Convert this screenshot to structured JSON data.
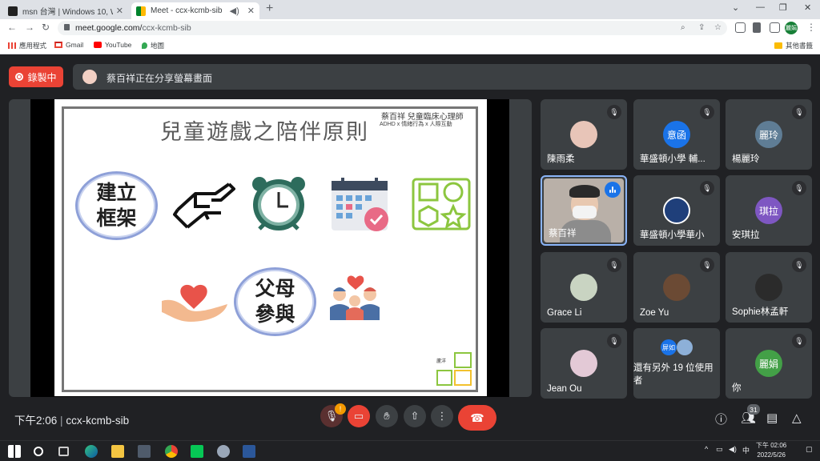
{
  "browser": {
    "tabs": [
      {
        "title": "msn 台灣 | Windows 10, Windo",
        "close": "✕"
      },
      {
        "title": "Meet - ccx-kcmb-sib",
        "close": "✕"
      }
    ],
    "url_host": "meet.google.com/",
    "url_path": "ccx-kcmb-sib",
    "profile": "麗娟",
    "bookmarks": [
      "應用程式",
      "Gmail",
      "YouTube",
      "地圖"
    ],
    "other_bookmarks": "其他書籤"
  },
  "meet": {
    "recording_label": "錄製中",
    "share_notice": "蔡百祥正在分享螢幕畫面",
    "time": "下午2:06",
    "meeting_code": "ccx-kcmb-sib",
    "notification_count": "!",
    "participant_count": "31"
  },
  "slide": {
    "title": "兒童遊戲之陪伴原則",
    "author": "蔡百祥 兒童臨床心理師",
    "subtitle": "ADHD x 情緒行為 x 人際互動",
    "bubble1_line1": "建立",
    "bubble1_line2": "框架",
    "bubble2_line1": "父母",
    "bubble2_line2": "參與",
    "logo_text": "蘆洋"
  },
  "participants": [
    {
      "name": "陳雨柔"
    },
    {
      "name": "華盛頓小學 輔...",
      "initials": "意函"
    },
    {
      "name": "楊麗玲",
      "initials": "麗玲"
    },
    {
      "name": "蔡百祥"
    },
    {
      "name": "華盛頓小學華小"
    },
    {
      "name": "安琪拉",
      "initials": "琪拉"
    },
    {
      "name": "Grace Li"
    },
    {
      "name": "Zoe Yu"
    },
    {
      "name": "Sophie林孟軒"
    },
    {
      "name": "Jean Ou"
    },
    {
      "name": "還有另外 19 位使用者",
      "chip": "屏如"
    },
    {
      "name": "你",
      "initials": "麗娟"
    }
  ],
  "taskbar": {
    "clock_time": "下午 02:06",
    "clock_date": "2022/5/26",
    "ime": "中"
  }
}
